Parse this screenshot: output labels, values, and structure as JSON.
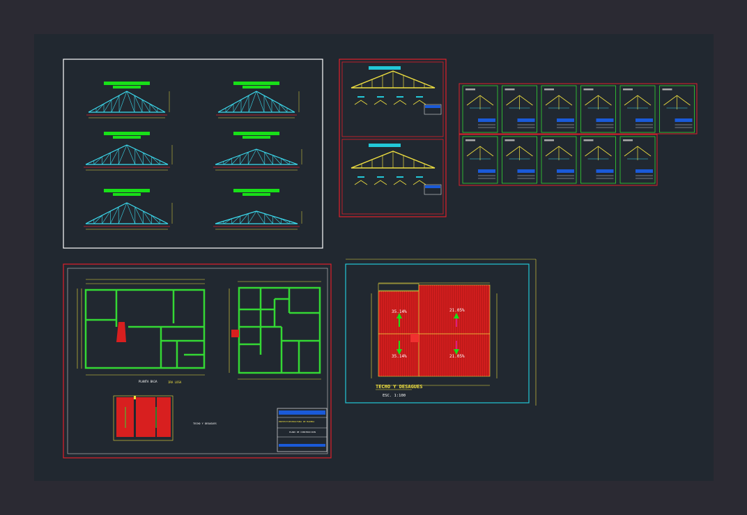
{
  "colors": {
    "background": "#2b2a33",
    "model_space": "#212830",
    "frame_white": "#ffffff",
    "frame_red": "#e0202a",
    "frame_cyan": "#22c8d8",
    "truss_cyan": "#3cdcf0",
    "truss_yellow": "#f0e040",
    "title_green": "#18e018",
    "wall_green": "#34d834",
    "roof_red": "#d81f1f",
    "text_white": "#ffffff"
  },
  "roof_plan": {
    "title": "TECHO Y DESAGUES",
    "scale": "ESC. 1:100",
    "slopes": [
      "35.14%",
      "21.05%",
      "35.14%",
      "21.05%"
    ]
  },
  "floor_plan_sheet": {
    "plan_label": "PLANTA BAJA",
    "plan_label_2": "1RA LOSA",
    "roof_label": "TECHO Y DESAGUES",
    "title_block": {
      "label_left": "PROYECTO:",
      "project": "ESTRUCTURA DE MADERA",
      "sheet_title": "PLANO DE CONSTRUCCION"
    }
  }
}
